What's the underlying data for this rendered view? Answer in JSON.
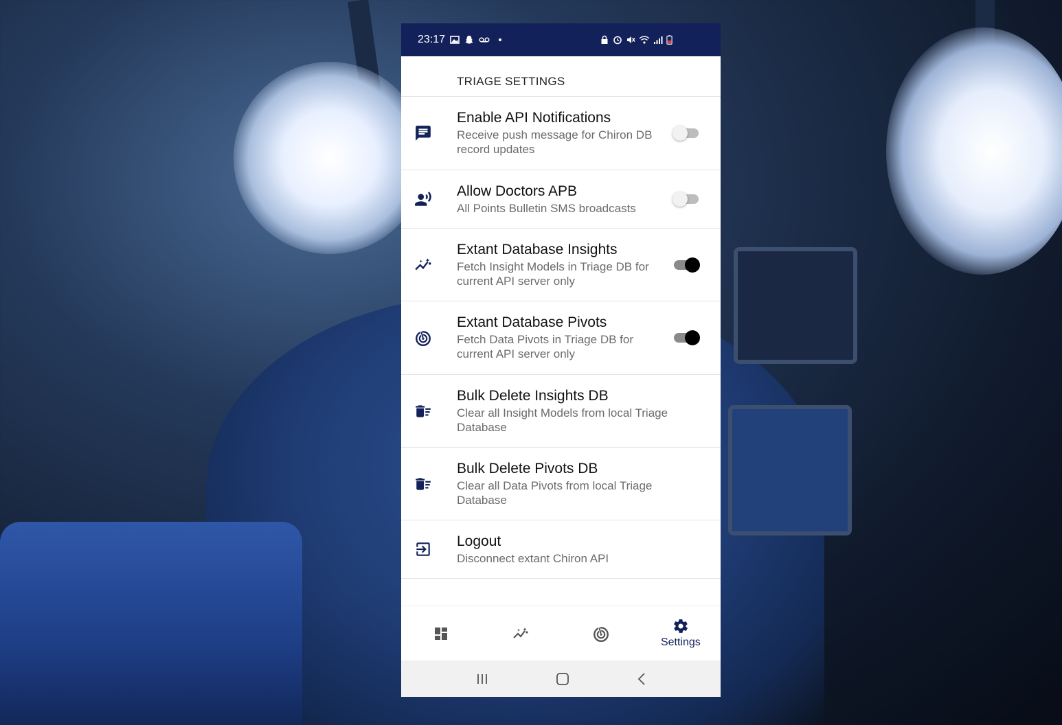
{
  "status_bar": {
    "time": "23:17"
  },
  "header": {
    "title": "TRIAGE SETTINGS"
  },
  "settings": [
    {
      "icon": "message-icon",
      "title": "Enable API Notifications",
      "subtitle": "Receive push message for Chiron DB record updates",
      "toggle": "off"
    },
    {
      "icon": "record-voice-icon",
      "title": "Allow Doctors APB",
      "subtitle": "All Points Bulletin SMS broadcasts",
      "toggle": "off"
    },
    {
      "icon": "insights-icon",
      "title": "Extant Database Insights",
      "subtitle": "Fetch Insight Models in Triage DB for current API server only",
      "toggle": "on"
    },
    {
      "icon": "radar-icon",
      "title": "Extant Database Pivots",
      "subtitle": "Fetch Data Pivots in Triage DB for current API server only",
      "toggle": "on"
    },
    {
      "icon": "delete-sweep-icon",
      "title": "Bulk Delete Insights DB",
      "subtitle": "Clear all Insight Models from local Triage Database"
    },
    {
      "icon": "delete-sweep-icon",
      "title": "Bulk Delete Pivots DB",
      "subtitle": "Clear all Data Pivots from local Triage Database"
    },
    {
      "icon": "logout-icon",
      "title": "Logout",
      "subtitle": "Disconnect extant Chiron API"
    }
  ],
  "bottom_nav": {
    "items": [
      {
        "icon": "dashboard-icon",
        "label": ""
      },
      {
        "icon": "insights-icon",
        "label": ""
      },
      {
        "icon": "radar-icon",
        "label": ""
      },
      {
        "icon": "gear-icon",
        "label": "Settings",
        "active": true
      }
    ]
  },
  "colors": {
    "primary": "#13215a",
    "status_bar": "#13215a",
    "toggle_on_knob": "#000000",
    "toggle_off_track": "#bdbdbd"
  }
}
